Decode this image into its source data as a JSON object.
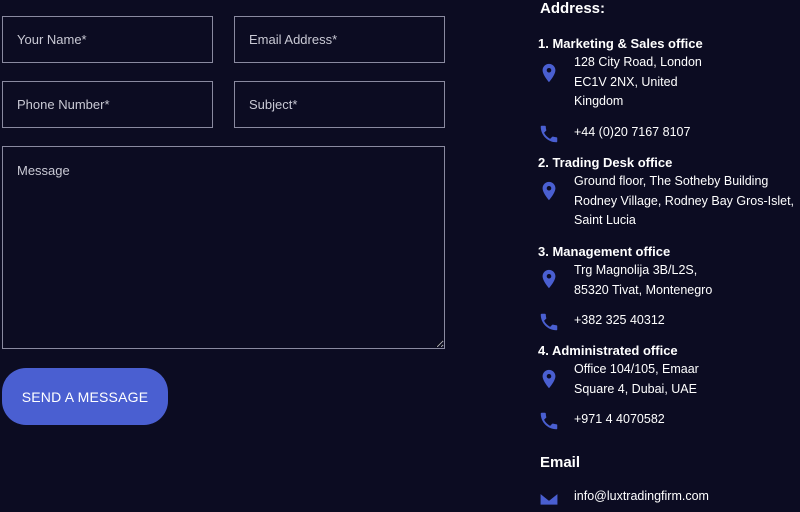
{
  "form": {
    "name_placeholder": "Your Name*",
    "email_placeholder": "Email Address*",
    "phone_placeholder": "Phone Number*",
    "subject_placeholder": "Subject*",
    "message_placeholder": "Message",
    "send_label": "SEND A MESSAGE"
  },
  "contact": {
    "address_heading": "Address:",
    "email_heading": "Email",
    "offices": [
      {
        "title": "1. Marketing & Sales office",
        "address": "128 City Road, London\nEC1V 2NX, United\nKingdom",
        "phone": "+44 (0)20 7167 8107"
      },
      {
        "title": "2. Trading Desk office",
        "address": "Ground floor, The Sotheby Building\nRodney Village, Rodney Bay Gros-Islet,\nSaint Lucia"
      },
      {
        "title": "3. Management office",
        "address": "Trg Magnolija 3B/L2S,\n85320 Tivat, Montenegro",
        "phone": "+382 325 40312"
      },
      {
        "title": "4. Administrated office",
        "address": "Office 104/105, Emaar\nSquare 4, Dubai, UAE",
        "phone": "+971 4 4070582"
      }
    ],
    "email": "info@luxtradingfirm.com"
  },
  "colors": {
    "background": "#0c0c22",
    "accent": "#4a5fd1",
    "field_border": "#8a8aa0"
  },
  "icons": {
    "location": "map-marker-icon",
    "phone": "phone-icon",
    "email": "envelope-icon"
  }
}
